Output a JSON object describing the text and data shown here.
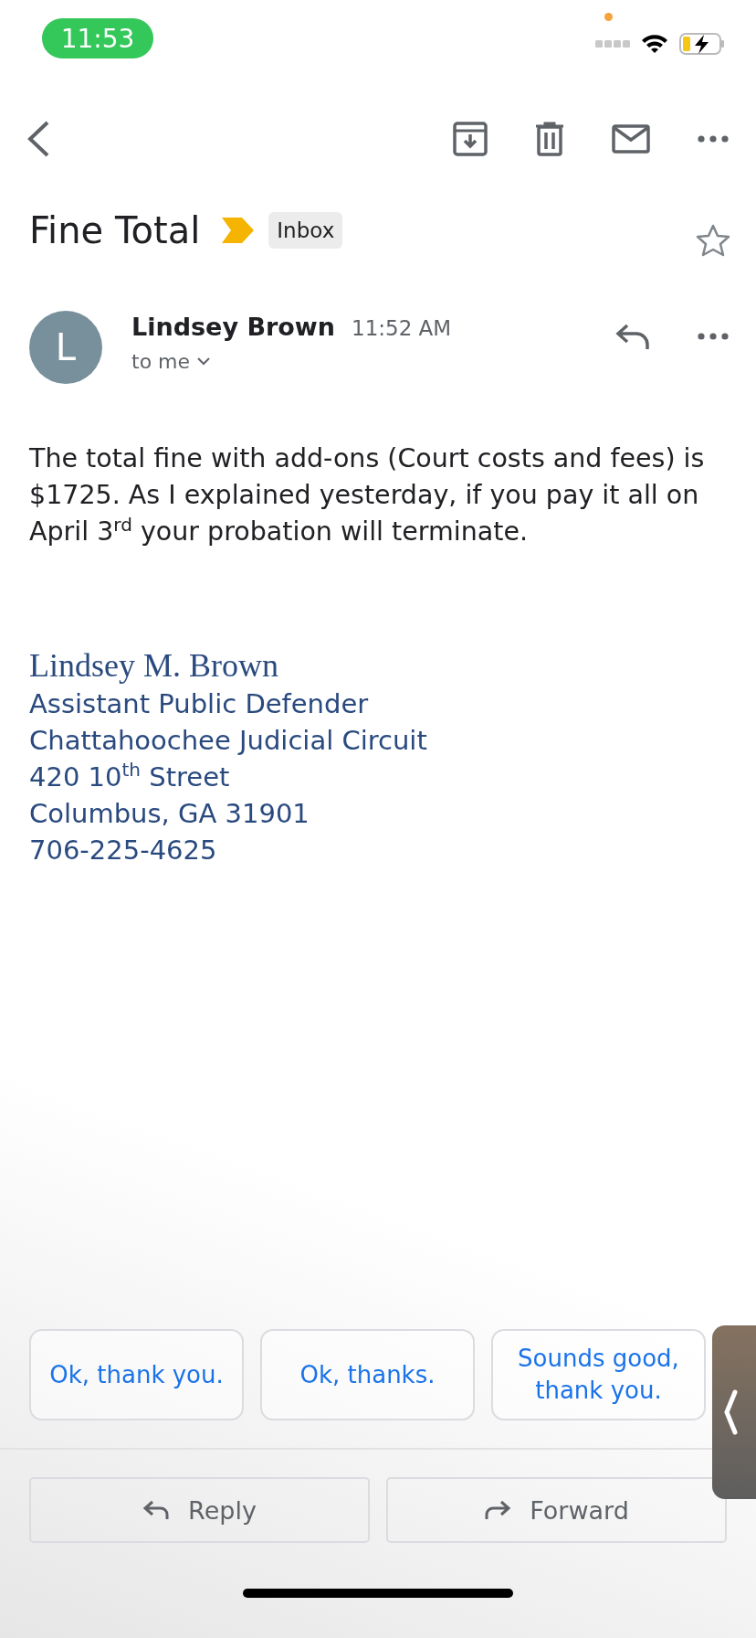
{
  "status_bar": {
    "time": "11:53"
  },
  "subject": {
    "title": "Fine Total",
    "important": true,
    "label": "Inbox",
    "starred": false
  },
  "message": {
    "sender": "Lindsey Brown",
    "avatar_letter": "L",
    "time": "11:52 AM",
    "recipient": "to me",
    "body": "The total fine with add-ons (Court costs and fees) is $1725. As I explained yesterday, if you pay it all on April 3$^{rd}$ your probation will terminate."
  },
  "signature": {
    "name": "Lindsey M. Brown",
    "lines": [
      "Assistant Public Defender",
      "Chattahoochee Judicial Circuit",
      "420 10$^{th}$ Street",
      "Columbus, GA 31901",
      "706-225-4625"
    ]
  },
  "quick_replies": [
    "Ok, thank you.",
    "Ok, thanks.",
    "Sounds good, thank you."
  ],
  "actions": [
    {
      "kind": "reply",
      "label": "Reply"
    },
    {
      "kind": "forward",
      "label": "Forward"
    }
  ]
}
